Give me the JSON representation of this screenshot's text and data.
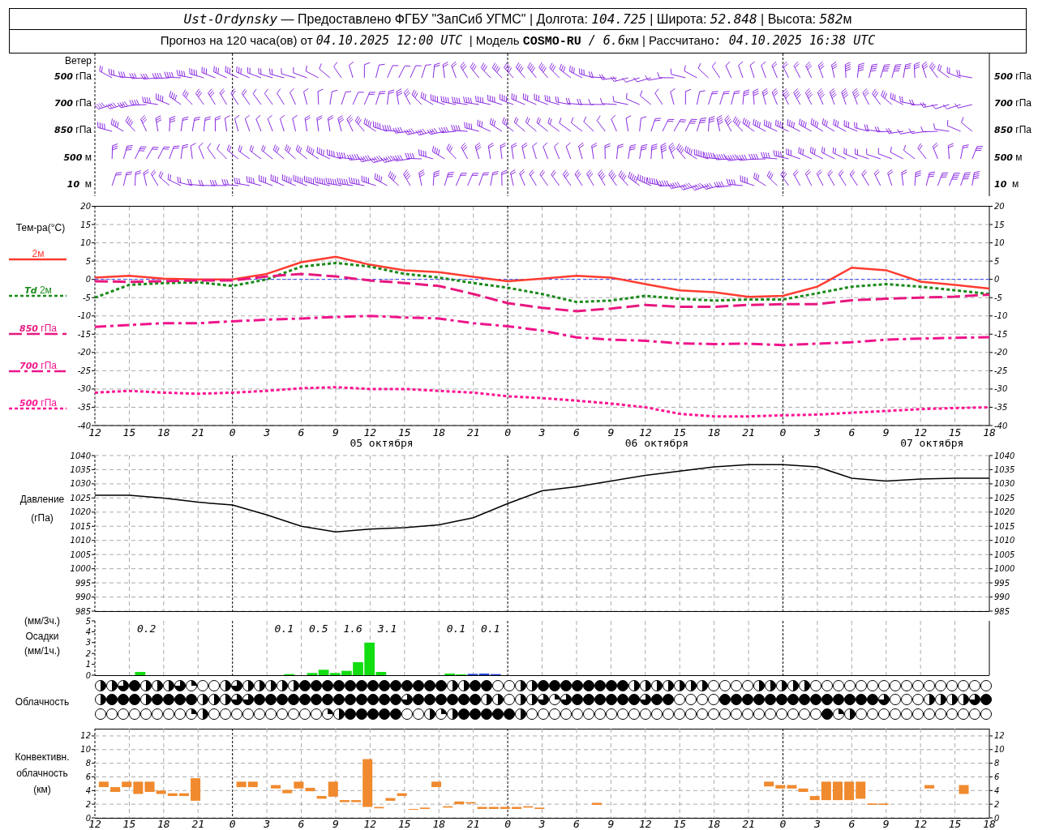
{
  "header": {
    "line_1": [
      {
        "kind": "italic",
        "text": "Ust-Ordynsky"
      },
      {
        "kind": "plain",
        "text": " — Предоставлено ФГБУ \"ЗапСиб УГМС\" | Долгота: "
      },
      {
        "kind": "italic",
        "text": "104.725"
      },
      {
        "kind": "plain",
        "text": " | Широта: "
      },
      {
        "kind": "italic",
        "text": "52.848"
      },
      {
        "kind": "plain",
        "text": " | Высота: "
      },
      {
        "kind": "italic",
        "text": "582"
      },
      {
        "kind": "plain",
        "text": "м"
      }
    ],
    "line_2": [
      {
        "kind": "plain",
        "text": "Прогноз на 120 часа(ов) от "
      },
      {
        "kind": "italic",
        "text": "04.10.2025 12:00 UTC"
      },
      {
        "kind": "plain",
        "text": "  | Модель "
      },
      {
        "kind": "bold",
        "text": "COSMO-RU"
      },
      {
        "kind": "italic",
        "text": " / 6.6"
      },
      {
        "kind": "plain",
        "text": "км | Рассчитано"
      },
      {
        "kind": "italic",
        "text": ": 04.10.2025 16:38 UTC"
      }
    ]
  },
  "wind": {
    "title": "Ветер",
    "levels_left": [
      "*500* гПа",
      "*700* гПа",
      "*850* гПа",
      "*500* м",
      "*10*  м"
    ],
    "levels_right": [
      "*500* гПа",
      "*700* гПа",
      "*850* гПа",
      "*500* м",
      "*10*  м"
    ]
  },
  "temperature": {
    "title": "Тем-ра(°C)",
    "date_labels": [
      "05 октября",
      "06 октября",
      "07 октября"
    ],
    "right_axis": [
      "20",
      "15",
      "10",
      "5",
      "0",
      "-5",
      "-10",
      "-15",
      "-20",
      "-25",
      "-30",
      "-35",
      "-40"
    ],
    "chart_data": {
      "type": "line",
      "grid": true,
      "ylim": [
        -40,
        20
      ],
      "ref_lines": [
        {
          "axis": "y",
          "value": 0,
          "color": "#3344ff"
        }
      ],
      "categories": [
        "12",
        "15",
        "18",
        "21",
        "0",
        "3",
        "6",
        "9",
        "12",
        "15",
        "18",
        "21",
        "0",
        "3",
        "6",
        "9",
        "12",
        "15",
        "18",
        "21",
        "0",
        "3",
        "6",
        "9",
        "12",
        "15",
        "18"
      ],
      "yticks": [
        20,
        15,
        10,
        5,
        0,
        -5,
        -10,
        -15,
        -20,
        -25,
        -30,
        -35,
        -40
      ],
      "series": [
        {
          "name": "2м",
          "color": "#ff3b30",
          "line_style": "solid",
          "values": [
            0.5,
            1,
            0.2,
            0,
            0,
            1.5,
            4.7,
            6.2,
            4,
            2.5,
            2,
            0.7,
            -0.5,
            0.2,
            1,
            0.5,
            -1.3,
            -3,
            -3.5,
            -4.8,
            -4.5,
            -2,
            3.2,
            2.5,
            -0.6,
            -1.5,
            -2.5
          ]
        },
        {
          "name": "*Td*  2м",
          "color": "#1a8a1a",
          "line_style": "dotted",
          "values": [
            -5,
            -1.5,
            -1,
            -0.8,
            -1.8,
            0,
            3.5,
            4.5,
            3.5,
            1.5,
            0.5,
            -1,
            -2.3,
            -4,
            -6.2,
            -5.8,
            -4.5,
            -5.3,
            -5.8,
            -5.5,
            -5.5,
            -3.8,
            -2,
            -1.3,
            -2,
            -3,
            -4
          ]
        },
        {
          "name": "*850* гПа",
          "color": "#e8177f",
          "line_style": "dashed",
          "values": [
            -0.5,
            -0.7,
            -0.5,
            -0.3,
            -0.3,
            0.8,
            1.5,
            0.8,
            -0.3,
            -1,
            -1.8,
            -4,
            -6.5,
            -7.8,
            -8.7,
            -8,
            -7,
            -7.5,
            -7.5,
            -7,
            -6.8,
            -6.8,
            -5.7,
            -5.3,
            -5,
            -4.7,
            -4.2
          ]
        },
        {
          "name": "*700* гПа",
          "color": "#f0148c",
          "line_style": "dashdot",
          "values": [
            -13,
            -12.5,
            -12,
            -12,
            -11.5,
            -11,
            -10.7,
            -10.3,
            -10,
            -10.4,
            -10.7,
            -12,
            -12.8,
            -14,
            -15.9,
            -16.5,
            -16.8,
            -17.5,
            -17.7,
            -17.6,
            -18,
            -17.6,
            -17.2,
            -16.5,
            -16.2,
            -16,
            -15.8
          ]
        },
        {
          "name": "*500* гПа",
          "color": "#ff1493",
          "line_style": "dotted",
          "values": [
            -31,
            -30.5,
            -31,
            -31.3,
            -31,
            -30.5,
            -29.8,
            -29.5,
            -30,
            -30,
            -30.5,
            -31,
            -32,
            -32.5,
            -33.2,
            -34,
            -35,
            -36.8,
            -37.5,
            -37.5,
            -37.2,
            -37,
            -36.5,
            -36,
            -35.5,
            -35.2,
            -35
          ]
        }
      ]
    }
  },
  "pressure": {
    "title": "Давление",
    "unit": "(гПа)",
    "right_axis": [
      "1040",
      "1035",
      "1030",
      "1025",
      "1020",
      "1015",
      "1010",
      "1005",
      "1000",
      "995",
      "990",
      "985"
    ],
    "chart_data": {
      "type": "line",
      "grid": true,
      "ylim": [
        985,
        1040
      ],
      "yticks": [
        1040,
        1035,
        1030,
        1025,
        1020,
        1015,
        1010,
        1005,
        1000,
        995,
        990,
        985
      ],
      "series": [
        {
          "color": "#000000",
          "values": [
            1026,
            1026,
            1025,
            1023.5,
            1022.5,
            1019,
            1015,
            1013,
            1014,
            1014.5,
            1015.5,
            1018,
            1023,
            1027.5,
            1029,
            1031,
            1033,
            1034.5,
            1036,
            1036.8,
            1036.8,
            1036,
            1032,
            1031,
            1031.7,
            1032,
            1032
          ]
        }
      ]
    }
  },
  "precipitation": {
    "labels": [
      "(мм/3ч.)",
      "Осадки",
      "(мм/1ч.)"
    ],
    "chart_data": {
      "type": "bar",
      "grid": true,
      "ylim": [
        0,
        5
      ],
      "yticks": [
        5,
        4,
        3,
        2,
        1,
        0
      ],
      "categories": [
        null,
        null,
        null,
        null,
        null,
        null,
        null,
        null,
        null,
        null,
        null,
        null,
        null,
        null,
        null,
        null,
        null,
        null,
        null,
        null,
        null,
        null,
        null,
        null,
        null,
        null,
        null,
        null,
        null,
        null,
        null,
        null,
        null,
        null,
        null,
        null,
        null,
        null,
        null,
        null,
        null,
        null,
        null,
        null,
        null,
        null,
        null,
        null,
        null,
        null,
        null,
        null,
        null,
        null,
        null,
        null,
        null,
        null,
        null,
        null,
        null,
        null,
        null,
        null,
        null,
        null,
        null,
        null,
        null,
        null,
        null,
        null,
        null,
        null,
        null,
        null,
        null,
        null,
        null
      ],
      "series": [
        {
          "color": "#11dd11",
          "values": [
            null,
            null,
            null,
            null,
            0.3,
            null,
            null,
            null,
            null,
            null,
            null,
            null,
            null,
            null,
            null,
            null,
            null,
            0.1,
            null,
            0.2,
            0.5,
            0.2,
            0.4,
            1.2,
            3.0,
            0.3,
            null,
            null,
            null,
            null,
            null,
            0.15,
            0.08,
            null,
            null,
            null,
            null,
            null,
            null,
            null,
            null,
            null,
            null,
            null,
            null,
            null,
            null,
            null,
            null,
            null,
            null,
            null,
            null,
            null,
            null,
            null,
            null,
            null,
            null,
            null,
            null,
            null,
            null,
            null,
            null,
            null,
            null,
            null,
            null,
            null,
            null,
            null,
            null,
            null,
            null,
            null,
            null,
            null,
            null
          ]
        },
        {
          "color": "#2244dd",
          "values": [
            null,
            null,
            null,
            null,
            null,
            null,
            null,
            null,
            null,
            null,
            null,
            null,
            null,
            null,
            null,
            null,
            null,
            null,
            null,
            null,
            null,
            null,
            null,
            null,
            null,
            null,
            null,
            null,
            null,
            null,
            null,
            null,
            null,
            0.12,
            0.15,
            0.1,
            null,
            null,
            null,
            null,
            null,
            null,
            null,
            null,
            null,
            null,
            null,
            null,
            null,
            null,
            null,
            null,
            null,
            null,
            null,
            null,
            null,
            null,
            null,
            null,
            null,
            null,
            null,
            null,
            null,
            null,
            null,
            null,
            null,
            null,
            null,
            null,
            null,
            null,
            null,
            null,
            null,
            null,
            null
          ]
        }
      ],
      "annotations": [
        "0.2",
        "0.1",
        "0.5",
        "1.6",
        "3.1",
        "0.1",
        "0.1"
      ]
    }
  },
  "cloudiness": {
    "title": "Облачность",
    "rows": [
      {
        "cells": [
          {
            "kind": "half"
          },
          {
            "kind": "half"
          },
          {
            "kind": "most"
          },
          {
            "kind": "full"
          },
          {
            "kind": "half"
          },
          {
            "kind": "half"
          },
          {
            "kind": "half"
          },
          {
            "kind": "most"
          },
          {
            "kind": "quarter"
          },
          {
            "kind": "clear"
          },
          {
            "kind": "clear"
          },
          {
            "kind": "half"
          },
          {
            "kind": "most"
          },
          {
            "kind": "half"
          },
          {
            "kind": "half"
          },
          {
            "kind": "half"
          },
          {
            "kind": "half"
          },
          {
            "kind": "half"
          },
          {
            "kind": "full"
          },
          {
            "kind": "full"
          },
          {
            "kind": "full"
          },
          {
            "kind": "full"
          },
          {
            "kind": "full"
          },
          {
            "kind": "full"
          },
          {
            "kind": "full"
          },
          {
            "kind": "full"
          },
          {
            "kind": "full"
          },
          {
            "kind": "full"
          },
          {
            "kind": "full"
          },
          {
            "kind": "full"
          },
          {
            "kind": "full"
          },
          {
            "kind": "half"
          },
          {
            "kind": "half"
          },
          {
            "kind": "full"
          },
          {
            "kind": "full"
          },
          {
            "kind": "clear"
          },
          {
            "kind": "clear"
          },
          {
            "kind": "half"
          },
          {
            "kind": "half"
          },
          {
            "kind": "full"
          },
          {
            "kind": "full"
          },
          {
            "kind": "full"
          },
          {
            "kind": "full"
          },
          {
            "kind": "full"
          },
          {
            "kind": "full"
          },
          {
            "kind": "full"
          },
          {
            "kind": "full"
          },
          {
            "kind": "half"
          },
          {
            "kind": "half"
          },
          {
            "kind": "half"
          },
          {
            "kind": "half"
          },
          {
            "kind": "half"
          },
          {
            "kind": "half"
          },
          {
            "kind": "half"
          },
          {
            "kind": "clear"
          },
          {
            "kind": "clear"
          },
          {
            "kind": "clear"
          },
          {
            "kind": "clear"
          },
          {
            "kind": "half"
          },
          {
            "kind": "half"
          },
          {
            "kind": "half"
          },
          {
            "kind": "half"
          },
          {
            "kind": "half"
          },
          {
            "kind": "clear"
          },
          {
            "kind": "clear"
          },
          {
            "kind": "clear"
          },
          {
            "kind": "clear"
          },
          {
            "kind": "clear"
          },
          {
            "kind": "clear"
          },
          {
            "kind": "clear"
          },
          {
            "kind": "clear"
          },
          {
            "kind": "clear"
          },
          {
            "kind": "clear"
          },
          {
            "kind": "clear"
          },
          {
            "kind": "clear"
          },
          {
            "kind": "clear"
          },
          {
            "kind": "clear"
          },
          {
            "kind": "clear"
          },
          {
            "kind": "clear"
          }
        ]
      },
      {
        "cells": [
          {
            "kind": "half"
          },
          {
            "kind": "full"
          },
          {
            "kind": "full"
          },
          {
            "kind": "full"
          },
          {
            "kind": "half"
          },
          {
            "kind": "full"
          },
          {
            "kind": "full"
          },
          {
            "kind": "full"
          },
          {
            "kind": "full"
          },
          {
            "kind": "half"
          },
          {
            "kind": "half"
          },
          {
            "kind": "half"
          },
          {
            "kind": "most"
          },
          {
            "kind": "most"
          },
          {
            "kind": "full"
          },
          {
            "kind": "full"
          },
          {
            "kind": "full"
          },
          {
            "kind": "full"
          },
          {
            "kind": "full"
          },
          {
            "kind": "full"
          },
          {
            "kind": "full"
          },
          {
            "kind": "full"
          },
          {
            "kind": "full"
          },
          {
            "kind": "full"
          },
          {
            "kind": "full"
          },
          {
            "kind": "full"
          },
          {
            "kind": "full"
          },
          {
            "kind": "most"
          },
          {
            "kind": "full"
          },
          {
            "kind": "full"
          },
          {
            "kind": "full"
          },
          {
            "kind": "full"
          },
          {
            "kind": "full"
          },
          {
            "kind": "full"
          },
          {
            "kind": "half"
          },
          {
            "kind": "half"
          },
          {
            "kind": "clear"
          },
          {
            "kind": "half"
          },
          {
            "kind": "half"
          },
          {
            "kind": "most"
          },
          {
            "kind": "quarter"
          },
          {
            "kind": "most"
          },
          {
            "kind": "full"
          },
          {
            "kind": "full"
          },
          {
            "kind": "full"
          },
          {
            "kind": "full"
          },
          {
            "kind": "full"
          },
          {
            "kind": "full"
          },
          {
            "kind": "most"
          },
          {
            "kind": "full"
          },
          {
            "kind": "full"
          },
          {
            "kind": "clear"
          },
          {
            "kind": "clear"
          },
          {
            "kind": "clear"
          },
          {
            "kind": "clear"
          },
          {
            "kind": "full"
          },
          {
            "kind": "full"
          },
          {
            "kind": "full"
          },
          {
            "kind": "full"
          },
          {
            "kind": "full"
          },
          {
            "kind": "full"
          },
          {
            "kind": "full"
          },
          {
            "kind": "full"
          },
          {
            "kind": "full"
          },
          {
            "kind": "full"
          },
          {
            "kind": "full"
          },
          {
            "kind": "full"
          },
          {
            "kind": "full"
          },
          {
            "kind": "full"
          },
          {
            "kind": "most"
          },
          {
            "kind": "clear"
          },
          {
            "kind": "clear"
          },
          {
            "kind": "clear"
          },
          {
            "kind": "half"
          },
          {
            "kind": "half"
          },
          {
            "kind": "half"
          },
          {
            "kind": "half"
          },
          {
            "kind": "most"
          },
          {
            "kind": "full"
          }
        ]
      },
      {
        "cells": [
          {
            "kind": "clear"
          },
          {
            "kind": "clear"
          },
          {
            "kind": "clear"
          },
          {
            "kind": "clear"
          },
          {
            "kind": "clear"
          },
          {
            "kind": "clear"
          },
          {
            "kind": "clear"
          },
          {
            "kind": "clear"
          },
          {
            "kind": "quarter"
          },
          {
            "kind": "half"
          },
          {
            "kind": "clear"
          },
          {
            "kind": "clear"
          },
          {
            "kind": "clear"
          },
          {
            "kind": "clear"
          },
          {
            "kind": "clear"
          },
          {
            "kind": "clear"
          },
          {
            "kind": "clear"
          },
          {
            "kind": "clear"
          },
          {
            "kind": "clear"
          },
          {
            "kind": "clear"
          },
          {
            "kind": "quarter"
          },
          {
            "kind": "half"
          },
          {
            "kind": "full"
          },
          {
            "kind": "full"
          },
          {
            "kind": "full"
          },
          {
            "kind": "full"
          },
          {
            "kind": "full"
          },
          {
            "kind": "clear"
          },
          {
            "kind": "clear"
          },
          {
            "kind": "half"
          },
          {
            "kind": "quarter"
          },
          {
            "kind": "half"
          },
          {
            "kind": "full"
          },
          {
            "kind": "full"
          },
          {
            "kind": "full"
          },
          {
            "kind": "full"
          },
          {
            "kind": "full"
          },
          {
            "kind": "half"
          },
          {
            "kind": "clear"
          },
          {
            "kind": "clear"
          },
          {
            "kind": "clear"
          },
          {
            "kind": "clear"
          },
          {
            "kind": "clear"
          },
          {
            "kind": "clear"
          },
          {
            "kind": "clear"
          },
          {
            "kind": "clear"
          },
          {
            "kind": "clear"
          },
          {
            "kind": "clear"
          },
          {
            "kind": "clear"
          },
          {
            "kind": "clear"
          },
          {
            "kind": "clear"
          },
          {
            "kind": "clear"
          },
          {
            "kind": "clear"
          },
          {
            "kind": "clear"
          },
          {
            "kind": "clear"
          },
          {
            "kind": "clear"
          },
          {
            "kind": "clear"
          },
          {
            "kind": "clear"
          },
          {
            "kind": "clear"
          },
          {
            "kind": "clear"
          },
          {
            "kind": "clear"
          },
          {
            "kind": "clear"
          },
          {
            "kind": "clear"
          },
          {
            "kind": "clear"
          },
          {
            "kind": "full"
          },
          {
            "kind": "quarter"
          },
          {
            "kind": "half"
          },
          {
            "kind": "clear"
          },
          {
            "kind": "clear"
          },
          {
            "kind": "clear"
          },
          {
            "kind": "clear"
          },
          {
            "kind": "clear"
          },
          {
            "kind": "clear"
          },
          {
            "kind": "clear"
          },
          {
            "kind": "clear"
          },
          {
            "kind": "clear"
          },
          {
            "kind": "clear"
          },
          {
            "kind": "clear"
          },
          {
            "kind": "clear"
          }
        ]
      }
    ]
  },
  "convective_clouds": {
    "labels": [
      "Конвективн.",
      "облачность",
      "(км)"
    ],
    "right_axis": [
      "12",
      "10",
      "8",
      "6",
      "4",
      "2",
      "0"
    ],
    "chart_data": {
      "type": "candlestick",
      "grid": true,
      "ylim": [
        0,
        13
      ],
      "yticks": [
        12,
        10,
        8,
        6,
        4,
        2,
        0
      ],
      "categories": [
        "12",
        null,
        null,
        "15",
        null,
        null,
        "18",
        null,
        null,
        "21",
        null,
        null,
        "0",
        null,
        null,
        "3",
        null,
        null,
        "6",
        null,
        null,
        "9",
        null,
        null,
        "12",
        null,
        null,
        "15",
        null,
        null,
        "18",
        null,
        null,
        "21",
        null,
        null,
        "0",
        null,
        null,
        "3",
        null,
        null,
        "6",
        null,
        null,
        "9",
        null,
        null,
        "12",
        null,
        null,
        "15",
        null,
        null,
        "18",
        null,
        null,
        "21",
        null,
        null,
        "0",
        null,
        null,
        "3",
        null,
        null,
        "6",
        null,
        null,
        "9",
        null,
        null,
        "12",
        null,
        null,
        "15",
        null,
        null,
        "18"
      ],
      "series": [
        {
          "color": "#f08a2e",
          "ohlc": [
            null,
            [
              4.5,
              5.3,
              4.5,
              5.3
            ],
            [
              3.8,
              4.5,
              3.8,
              4.5
            ],
            [
              4.5,
              5.3,
              4.5,
              5.3
            ],
            [
              3.5,
              5.3,
              3.5,
              5.3
            ],
            [
              3.8,
              5.3,
              3.8,
              5.3
            ],
            [
              3.5,
              4.0,
              3.5,
              4.0
            ],
            [
              3.2,
              3.6,
              3.2,
              3.6
            ],
            [
              3.2,
              3.6,
              3.2,
              3.6
            ],
            [
              2.5,
              5.8,
              2.5,
              5.8
            ],
            null,
            null,
            null,
            [
              4.5,
              5.3,
              4.5,
              5.3
            ],
            [
              4.5,
              5.3,
              4.5,
              5.3
            ],
            null,
            [
              4.3,
              4.8,
              4.3,
              4.8
            ],
            [
              3.6,
              4.1,
              3.6,
              4.1
            ],
            [
              4.3,
              5.3,
              4.3,
              5.3
            ],
            [
              3.9,
              4.4,
              3.9,
              4.4
            ],
            [
              2.8,
              3.2,
              2.8,
              3.2
            ],
            [
              3.1,
              5.3,
              3.1,
              5.3
            ],
            [
              2.3,
              2.6,
              2.3,
              2.6
            ],
            [
              2.3,
              2.6,
              2.3,
              2.6
            ],
            [
              1.6,
              8.6,
              1.6,
              8.6
            ],
            [
              1.4,
              1.6,
              1.4,
              1.6
            ],
            [
              2.5,
              2.9,
              2.5,
              2.9
            ],
            [
              3.2,
              3.6,
              3.2,
              3.6
            ],
            [
              1.2,
              1.3,
              1.2,
              1.3
            ],
            [
              1.3,
              1.5,
              1.3,
              1.5
            ],
            [
              4.5,
              5.3,
              4.5,
              5.3
            ],
            [
              1.5,
              1.7,
              1.5,
              1.7
            ],
            [
              2.0,
              2.4,
              2.0,
              2.4
            ],
            [
              2.1,
              2.3,
              2.1,
              2.3
            ],
            [
              1.3,
              1.6,
              1.3,
              1.6
            ],
            [
              1.3,
              1.6,
              1.3,
              1.6
            ],
            [
              1.3,
              1.6,
              1.3,
              1.6
            ],
            [
              1.3,
              1.6,
              1.3,
              1.6
            ],
            [
              1.5,
              1.7,
              1.5,
              1.7
            ],
            [
              1.3,
              1.5,
              1.3,
              1.5
            ],
            null,
            null,
            null,
            null,
            [
              1.9,
              2.2,
              1.9,
              2.2
            ],
            null,
            null,
            null,
            null,
            null,
            null,
            null,
            null,
            null,
            null,
            null,
            null,
            null,
            null,
            [
              4.6,
              5.3,
              4.6,
              5.3
            ],
            [
              4.3,
              4.8,
              4.3,
              4.8
            ],
            [
              4.3,
              4.8,
              4.3,
              4.8
            ],
            [
              3.8,
              4.3,
              3.8,
              4.3
            ],
            [
              2.6,
              3.2,
              2.6,
              3.2
            ],
            [
              2.6,
              5.3,
              2.6,
              5.3
            ],
            [
              2.6,
              5.3,
              2.6,
              5.3
            ],
            [
              2.6,
              5.3,
              2.6,
              5.3
            ],
            [
              2.8,
              5.3,
              2.8,
              5.3
            ],
            [
              1.9,
              2.1,
              1.9,
              2.1
            ],
            [
              1.9,
              2.1,
              1.9,
              2.1
            ],
            null,
            null,
            null,
            [
              4.3,
              4.8,
              4.3,
              4.8
            ],
            null,
            null,
            [
              3.5,
              4.8,
              3.5,
              4.8
            ],
            null,
            null
          ]
        }
      ]
    }
  }
}
